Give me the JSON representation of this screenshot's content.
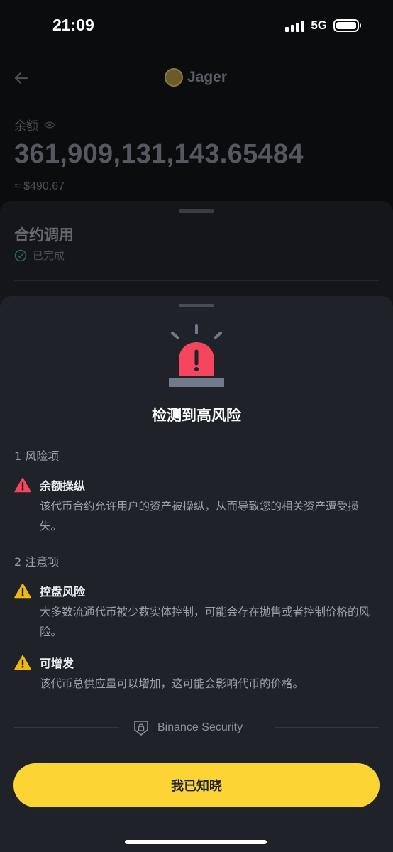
{
  "status_bar": {
    "time": "21:09",
    "network": "5G"
  },
  "background": {
    "token_name": "Jager",
    "balance_label": "余额",
    "balance_amount": "361,909,131,143.65484",
    "balance_fiat": "≈ $490.67",
    "sheet_title": "合约调用",
    "sheet_status": "已完成"
  },
  "risk_sheet": {
    "title": "检测到高风险",
    "risk_section_label": "1 风险项",
    "risk_items": [
      {
        "title": "余额操纵",
        "desc": "该代币合约允许用户的资产被操纵，从而导致您的相关资产遭受损失。",
        "severity": "high"
      }
    ],
    "notice_section_label": "2 注意项",
    "notice_items": [
      {
        "title": "控盘风险",
        "desc": "大多数流通代币被少数实体控制，可能会存在抛售或者控制价格的风险。",
        "severity": "warning"
      },
      {
        "title": "可增发",
        "desc": "该代币总供应量可以增加，这可能会影响代币的价格。",
        "severity": "warning"
      }
    ],
    "footer_brand": "Binance Security",
    "ack_button": "我已知晓"
  },
  "colors": {
    "accent": "#fcd535",
    "danger": "#f6465d",
    "warning": "#f0b90b",
    "sheet_bg": "#1f2329"
  },
  "icons": [
    "back-arrow-icon",
    "token-logo-icon",
    "eye-icon",
    "check-circle-icon",
    "alarm-icon",
    "danger-triangle-icon",
    "warning-triangle-icon",
    "shield-lock-icon"
  ]
}
